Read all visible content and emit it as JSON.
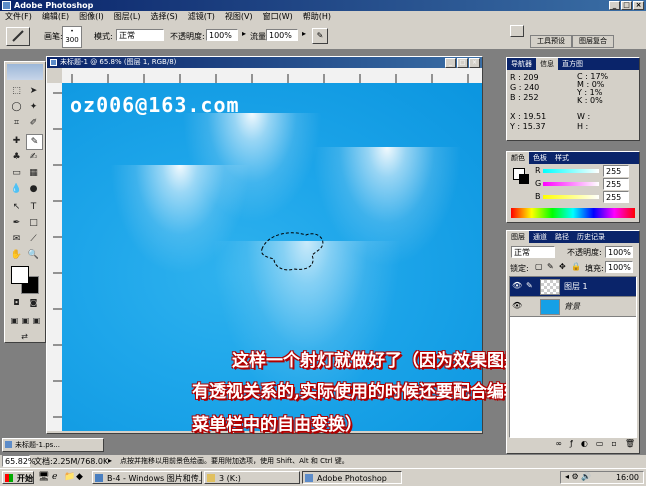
{
  "app": {
    "title": "Adobe Photoshop"
  },
  "menu": [
    "文件(F)",
    "编辑(E)",
    "图像(I)",
    "图层(L)",
    "选择(S)",
    "滤镜(T)",
    "视图(V)",
    "窗口(W)",
    "帮助(H)"
  ],
  "options": {
    "brush_label": "画笔:",
    "brush_size": "300",
    "mode_label": "模式:",
    "mode_value": "正常",
    "opacity_label": "不透明度:",
    "opacity_value": "100%",
    "flow_label": "流量:",
    "flow_value": "100%"
  },
  "palette_well": {
    "tab1": "工具预设",
    "tab2": "图层复合"
  },
  "document": {
    "title": "未标题-1 @ 65.8% (图层 1, RGB/8)"
  },
  "watermark": "oz006@163.com",
  "caption": {
    "line1": "这样一个射灯就做好了（因为效果图是",
    "line2": "有透视关系的,实际使用的时候还要配合编辑",
    "line3": "菜单栏中的自由变换）"
  },
  "info_panel": {
    "tabs": [
      "导航器",
      "信息",
      "直方图"
    ],
    "r_label": "R :",
    "r": "209",
    "g_label": "G :",
    "g": "240",
    "b_label": "B :",
    "b": "252",
    "c_label": "C :",
    "c": "17%",
    "m_label": "M :",
    "m": "0%",
    "y_label": "Y :",
    "y": "1%",
    "k_label": "K :",
    "k": "0%",
    "x_label": "X :",
    "x": "19.51",
    "y2_label": "Y :",
    "y2": "15.37",
    "w_label": "W :",
    "h_label": "H :"
  },
  "color_panel": {
    "tabs": [
      "颜色",
      "色板",
      "样式"
    ],
    "r_label": "R",
    "r": "255",
    "g_label": "G",
    "g": "255",
    "b_label": "B",
    "b": "255"
  },
  "layers_panel": {
    "tabs": [
      "图层",
      "通道",
      "路径",
      "历史记录"
    ],
    "blend": "正常",
    "opacity_label": "不透明度:",
    "opacity": "100%",
    "lock_label": "锁定:",
    "fill_label": "填充:",
    "fill": "100%",
    "layers": [
      {
        "name": "图层 1"
      },
      {
        "name": "背景"
      }
    ]
  },
  "minimized_doc": "未标题-1.ps...",
  "status": {
    "zoom": "65.82%",
    "doc_size": "文档:2.25M/768.0K",
    "hint": "点按并拖移以用前景色绘画。要用附加选项，使用 Shift、Alt 和 Ctrl 键。"
  },
  "taskbar": {
    "start": "开始",
    "items": [
      "B-4 - Windows 图片和传...",
      "3 (K:)",
      "Adobe Photoshop"
    ],
    "clock": "16:00"
  },
  "colors": {
    "canvas": "#16a0e6",
    "title_blue": "#0a246a",
    "caption_red": "#b00000"
  }
}
